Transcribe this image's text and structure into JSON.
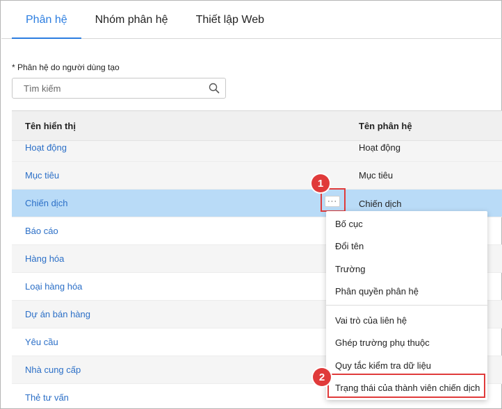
{
  "tabs": [
    {
      "label": "Phân hệ",
      "active": true
    },
    {
      "label": "Nhóm phân hệ",
      "active": false
    },
    {
      "label": "Thiết lập Web",
      "active": false
    }
  ],
  "section_label": "* Phân hệ do người dùng tạo",
  "search": {
    "placeholder": "Tìm kiếm",
    "value": ""
  },
  "table": {
    "headers": [
      "Tên hiển thị",
      "Tên phân hệ"
    ],
    "rows": [
      {
        "display_name": "Hoạt động",
        "module_name": "Hoạt động"
      },
      {
        "display_name": "Mục tiêu",
        "module_name": "Mục tiêu"
      },
      {
        "display_name": "Chiến dịch",
        "module_name": "Chiến dịch",
        "selected": true
      },
      {
        "display_name": "Báo cáo",
        "module_name": ""
      },
      {
        "display_name": "Hàng hóa",
        "module_name": ""
      },
      {
        "display_name": "Loại hàng hóa",
        "module_name": ""
      },
      {
        "display_name": "Dự án bán hàng",
        "module_name": ""
      },
      {
        "display_name": "Yêu cầu",
        "module_name": ""
      },
      {
        "display_name": "Nhà cung cấp",
        "module_name": ""
      },
      {
        "display_name": "Thẻ tư vấn",
        "module_name": ""
      }
    ]
  },
  "more_button": {
    "label": "···"
  },
  "menu": {
    "group1": [
      "Bố cục",
      "Đổi tên",
      "Trường",
      "Phân quyền phân hệ"
    ],
    "group2": [
      "Vai trò của liên hệ",
      "Ghép trường phụ thuộc",
      "Quy tắc kiểm tra dữ liệu",
      "Trạng thái của thành viên chiến dịch"
    ]
  },
  "callouts": {
    "step1": "1",
    "step2": "2",
    "color": "#e03a3a"
  },
  "colors": {
    "accent": "#2b7de0",
    "link": "#2b6fc7",
    "selected_row": "#b9dbf7",
    "header_bg": "#f0f0f0"
  },
  "icons": {
    "search": "search-icon",
    "more": "ellipsis-icon"
  }
}
